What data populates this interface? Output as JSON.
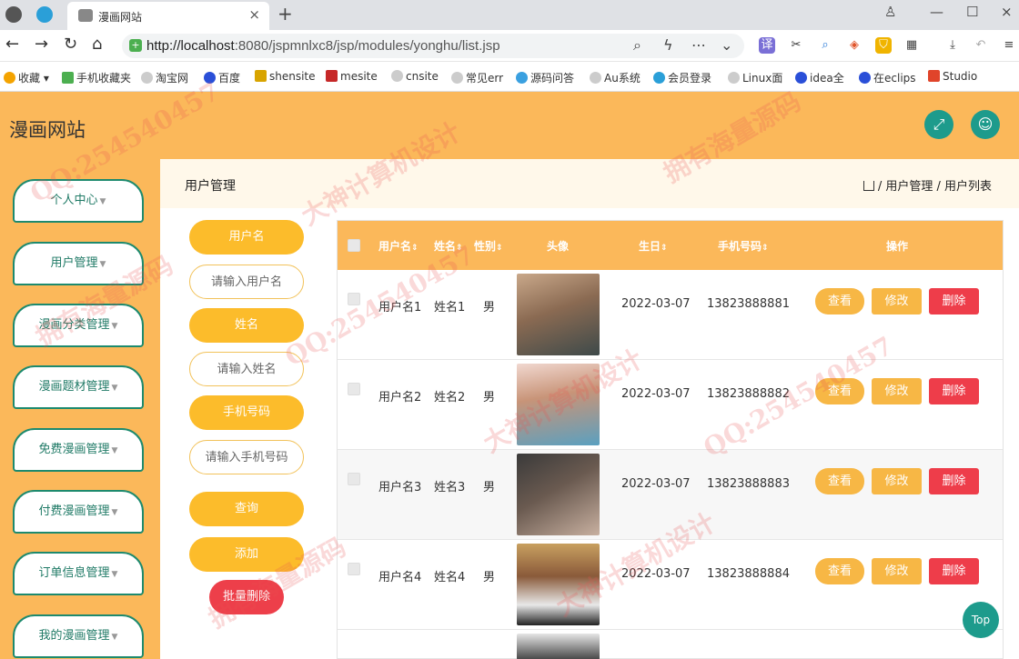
{
  "browser": {
    "tab_title": "漫画网站",
    "url_host": "http://localhost",
    "url_rest": ":8080/jspmnlxc8/jsp/modules/yonghu/list.jsp",
    "bookmarks": [
      "收藏",
      "手机收藏夹",
      "淘宝网",
      "百度",
      "shensite",
      "mesite",
      "cnsite",
      "常见err",
      "源码问答",
      "Au系统",
      "会员登录",
      "Linux面",
      "idea全",
      "在eclips",
      "Studio"
    ]
  },
  "header": {
    "site_title": "漫画网站"
  },
  "sidebar": {
    "items": [
      {
        "label": "个人中心"
      },
      {
        "label": "用户管理"
      },
      {
        "label": "漫画分类管理"
      },
      {
        "label": "漫画题材管理"
      },
      {
        "label": "免费漫画管理"
      },
      {
        "label": "付费漫画管理"
      },
      {
        "label": "订单信息管理"
      },
      {
        "label": "我的漫画管理"
      }
    ]
  },
  "breadcrumb": {
    "title": "用户管理",
    "path": "/ 用户管理 / 用户列表"
  },
  "search": {
    "username_label": "用户名",
    "username_placeholder": "请输入用户名",
    "name_label": "姓名",
    "name_placeholder": "请输入姓名",
    "phone_label": "手机号码",
    "phone_placeholder": "请输入手机号码",
    "query_button": "查询",
    "add_button": "添加",
    "batch_delete_button": "批量删除"
  },
  "table": {
    "headers": {
      "username": "用户名",
      "name": "姓名",
      "gender": "性别",
      "avatar": "头像",
      "birthday": "生日",
      "phone": "手机号码",
      "actions": "操作"
    },
    "action_labels": {
      "view": "查看",
      "edit": "修改",
      "delete": "删除"
    },
    "rows": [
      {
        "username": "用户名1",
        "name": "姓名1",
        "gender": "男",
        "birthday": "2022-03-07",
        "phone": "13823888881"
      },
      {
        "username": "用户名2",
        "name": "姓名2",
        "gender": "男",
        "birthday": "2022-03-07",
        "phone": "13823888882"
      },
      {
        "username": "用户名3",
        "name": "姓名3",
        "gender": "男",
        "birthday": "2022-03-07",
        "phone": "13823888883"
      },
      {
        "username": "用户名4",
        "name": "姓名4",
        "gender": "男",
        "birthday": "2022-03-07",
        "phone": "13823888884"
      }
    ]
  },
  "top_button": "Top",
  "watermarks": [
    "QQ:254540457",
    "拥有海量源码",
    "大神计算机设计"
  ],
  "colors": {
    "primary": "#fbb85a",
    "accent": "#1d9b8c",
    "danger": "#ee3d4a",
    "button": "#fcbc2b"
  }
}
